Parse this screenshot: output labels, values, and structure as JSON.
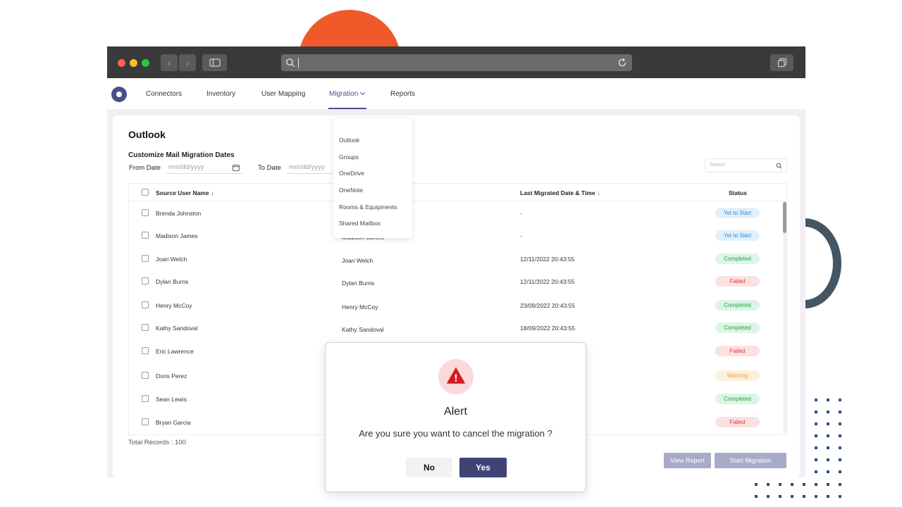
{
  "browser": {
    "back_glyph": "‹",
    "forward_glyph": "›",
    "icons": [
      "search-icon",
      "reload-icon",
      "sidebar-icon",
      "tabs-icon"
    ]
  },
  "nav": {
    "items": [
      {
        "label": "Connectors"
      },
      {
        "label": "Inventory"
      },
      {
        "label": "User Mapping"
      },
      {
        "label": "Migration",
        "active": true
      },
      {
        "label": "Reports"
      }
    ]
  },
  "page": {
    "title": "Outlook",
    "section_label": "Customize Mail Migration Dates",
    "from_date_label": "From Date",
    "from_date_placeholder": "mm/dd/yyyy",
    "to_date_label": "To Date",
    "to_date_placeholder": "mm/dd/yyyy",
    "search_placeholder": "Search"
  },
  "table": {
    "headers": {
      "source_user": "Source User Name ↓",
      "last_migrated": "Last Migrated Date & Time ↓",
      "status": "Status"
    },
    "rows": [
      {
        "source": "Brenda Johnston",
        "target": "",
        "date": "-",
        "status": "Yet to Start",
        "status_type": "yet"
      },
      {
        "source": "Madison James",
        "target": "Madison James",
        "date": "-",
        "status": "Yet to Start",
        "status_type": "yet"
      },
      {
        "source": "Joan Welch",
        "target": "Joan Welch",
        "date": "12/11/2022 20:43:55",
        "status": "Completed",
        "status_type": "completed"
      },
      {
        "source": "Dylan Burns",
        "target": "Dylan Burns",
        "date": "12/11/2022 20:43:55",
        "status": "Failed",
        "status_type": "failed"
      },
      {
        "source": "Henry McCoy",
        "target": "Henry McCoy",
        "date": "23/09/2022 20:43:55",
        "status": "Completed",
        "status_type": "completed"
      },
      {
        "source": "Kathy Sandoval",
        "target": "Kathy Sandoval",
        "date": "18/09/2022 20:43:55",
        "status": "Completed",
        "status_type": "completed"
      },
      {
        "source": "Eric Lawrence",
        "target": "",
        "date": "",
        "status": "Failed",
        "status_type": "failed"
      },
      {
        "source": "Doris Perez",
        "target": "",
        "date": "",
        "status": "Warning",
        "status_type": "warning"
      },
      {
        "source": "Sean Lewis",
        "target": "",
        "date": "",
        "status": "Completed",
        "status_type": "completed"
      },
      {
        "source": "Bryan Garcia",
        "target": "",
        "date": "",
        "status": "Failed",
        "status_type": "failed"
      }
    ],
    "total_records": "Total Records : 100"
  },
  "actions": {
    "view_report": "View Report",
    "start_migration": "Start Migration"
  },
  "dropdown": {
    "items": [
      "Outlook",
      "Groups",
      "OneDrive",
      "OneNote",
      "Rooms & Equipments",
      "Shared Mailbox"
    ]
  },
  "modal": {
    "icon_glyph": "!",
    "title": "Alert",
    "message": "Are you sure you want to cancel the migration ?",
    "no_label": "No",
    "yes_label": "Yes"
  },
  "colors": {
    "accent": "#4a4f8c",
    "deco_orange": "#f05a2a",
    "deco_slate": "#445563",
    "alert_red": "#d71920"
  }
}
